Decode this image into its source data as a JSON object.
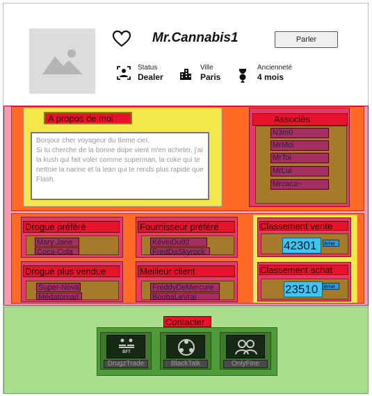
{
  "profile": {
    "username": "Mr.Cannabis1",
    "talk_label": "Parler",
    "stats": [
      {
        "label": "Status",
        "value": "Dealer",
        "icon": "user-badge-icon"
      },
      {
        "label": "Ville",
        "value": "Paris",
        "icon": "buildings-icon"
      },
      {
        "label": "Ancienneté",
        "value": "4 mois",
        "icon": "medal-icon"
      }
    ]
  },
  "about": {
    "title": "A propos de moi",
    "text": "Bonjour cher voyageur du 8eme ciel.\nSi tu cherche de la bonne dope vient m'en acheter, j'ai la kush qui fait voler comme superman, la coke qui te nettoie la narine et la lean qui te rends plus rapide que Flash."
  },
  "associates": {
    "title": "Associés",
    "items": [
      "N3m0",
      "MrMoi",
      "MrToi",
      "MrLui",
      "Mrcaca~"
    ]
  },
  "favorite_drug": {
    "title": "Drogue préféré",
    "items": [
      "Mary Jane",
      "Coca-Cola"
    ]
  },
  "favorite_supplier": {
    "title": "Fournisseur préféré",
    "items": [
      "KévinDu92",
      "FredDaSkyrock"
    ]
  },
  "most_sold": {
    "title": "Drogue plus vendue",
    "items": [
      "Super-Nova",
      "Médatomari"
    ]
  },
  "best_client": {
    "title": "Meilleur client",
    "items": [
      "FreddyDeMercure",
      "BoobaLeVrai"
    ]
  },
  "sales_rank": {
    "title": "Classement vente",
    "value": "42301",
    "unit": "ème"
  },
  "purchase_rank": {
    "title": "Classement achat",
    "value": "23510",
    "unit": "ème"
  },
  "contact": {
    "title": "Contacter",
    "apps": [
      {
        "name": "DrugzTrade",
        "icon": "drugztrade-icon",
        "badge": "BFT"
      },
      {
        "name": "BlackTalk",
        "icon": "blacktalk-icon"
      },
      {
        "name": "OnlyFine",
        "icon": "onlyfine-icon"
      }
    ]
  },
  "colors": {
    "orange": "#ff6b26",
    "pink": "#e8386b",
    "yellow": "#f2e84a",
    "red": "#e8132b",
    "green": "#abde8c"
  }
}
